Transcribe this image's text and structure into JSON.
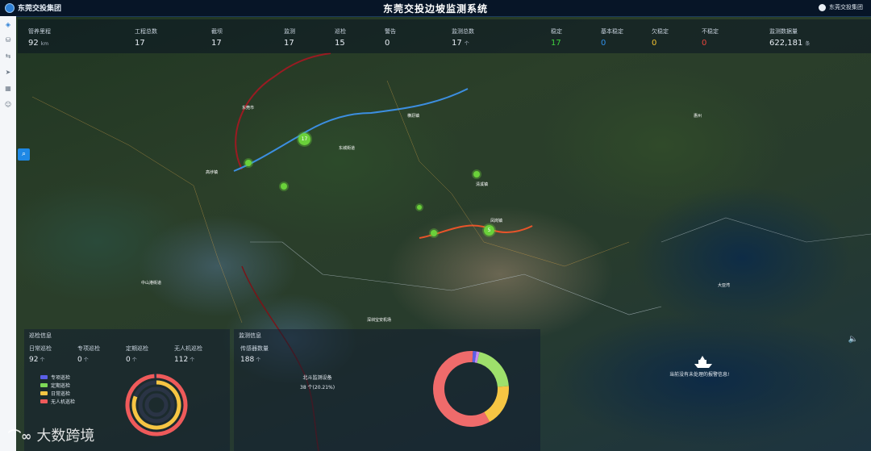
{
  "header": {
    "company": "东莞交投集团",
    "title": "东莞交投边坡监测系统",
    "user_name": "东莞交投集团"
  },
  "sidebar": {
    "icons": [
      "layers-icon",
      "database-icon",
      "route-icon",
      "send-icon",
      "building-icon",
      "user-icon"
    ]
  },
  "stats": [
    {
      "label": "管养里程",
      "value": "92",
      "unit": "km"
    },
    {
      "label": "工程总数",
      "value": "17",
      "unit": ""
    },
    {
      "label": "截坝",
      "value": "17",
      "unit": ""
    },
    {
      "label": "监测",
      "value": "17",
      "unit": ""
    },
    {
      "label": "巡检",
      "value": "15",
      "unit": ""
    },
    {
      "label": "警告",
      "value": "0",
      "unit": ""
    },
    {
      "label": "监测总数",
      "value": "17",
      "unit": "个"
    },
    {
      "label": "稳定",
      "value": "17",
      "unit": ""
    },
    {
      "label": "基本稳定",
      "value": "0",
      "unit": ""
    },
    {
      "label": "欠稳定",
      "value": "0",
      "unit": ""
    },
    {
      "label": "不稳定",
      "value": "0",
      "unit": ""
    },
    {
      "label": "监测数据量",
      "value": "622,181",
      "unit": "条"
    }
  ],
  "stat_colors": {
    "stable": "#3ecf3e",
    "basic_stable": "#2f8fe8",
    "less_stable": "#f2c230",
    "unstable": "#e8453c"
  },
  "inspection_panel": {
    "title": "巡检信息",
    "items": [
      {
        "label": "日常巡检",
        "value": "92",
        "unit": "个"
      },
      {
        "label": "专项巡检",
        "value": "0",
        "unit": "个"
      },
      {
        "label": "定期巡检",
        "value": "0",
        "unit": "个"
      },
      {
        "label": "无人机巡检",
        "value": "112",
        "unit": "个"
      }
    ],
    "legend": [
      {
        "name": "专项巡检",
        "color": "#5b5fe6"
      },
      {
        "name": "定期巡检",
        "color": "#7ed957"
      },
      {
        "name": "日常巡检",
        "color": "#f6c543"
      },
      {
        "name": "无人机巡检",
        "color": "#ef5a5a"
      }
    ]
  },
  "monitor_panel": {
    "title": "监测信息",
    "device_label": "传感器数量",
    "device_value": "188",
    "device_unit": "个",
    "callout_title": "北斗监测设备",
    "callout_value": "38 个(20.21%)"
  },
  "chart_data": [
    {
      "type": "pie",
      "title": "",
      "labels": [
        "专项巡检",
        "定期巡检",
        "日常巡检",
        "无人机巡检"
      ],
      "values": [
        0,
        0,
        92,
        112
      ],
      "colors": [
        "#5b5fe6",
        "#7ed957",
        "#f6c543",
        "#ef5a5a"
      ]
    },
    {
      "type": "pie",
      "title": "",
      "labels": [
        "北斗监测设备"
      ],
      "values": [
        38
      ],
      "slices_percent": [
        59.0,
        20.21,
        18.0,
        1.5,
        1.3
      ],
      "colors": [
        "#ef6b6b",
        "#9ee06b",
        "#f6c543",
        "#5b5fe6",
        "#c58cf0"
      ]
    }
  ],
  "map": {
    "markers": [
      {
        "label": "17"
      },
      {
        "label": ""
      },
      {
        "label": ""
      },
      {
        "label": ""
      },
      {
        "label": ""
      },
      {
        "label": "5"
      },
      {
        "label": ""
      }
    ],
    "places": [
      "中山港街道",
      "东莞市",
      "高埗镇",
      "横沥镇",
      "东城街道",
      "深圳宝安机场",
      "清溪镇",
      "凤岗镇",
      "惠州",
      "大亚湾"
    ],
    "alarm_text": "当前没有未处理的报警信息!"
  },
  "watermark": {
    "text": "大数跨境"
  }
}
